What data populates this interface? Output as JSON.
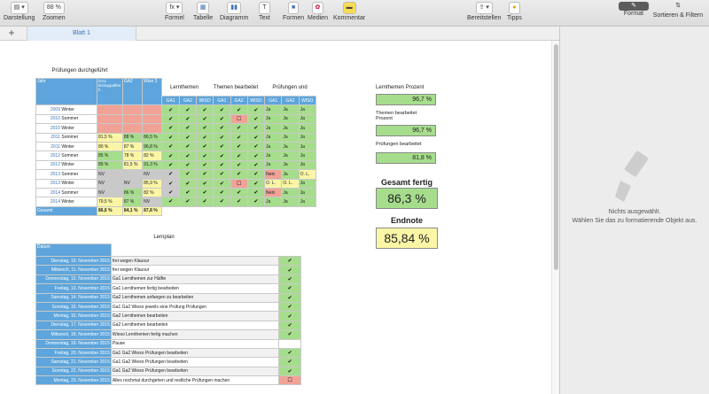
{
  "toolbar": {
    "items": [
      {
        "icon": "sidebar-icon",
        "label": "Darstellung"
      },
      {
        "icon": "zoom",
        "value": "88 %",
        "label": "Zoomen"
      },
      {
        "icon": "fx-icon",
        "label": "Formel"
      },
      {
        "icon": "table-icon",
        "label": "Tabelle"
      },
      {
        "icon": "chart-icon",
        "label": "Diagramm"
      },
      {
        "icon": "text-icon",
        "label": "Text"
      },
      {
        "icon": "shapes-icon",
        "label": "Formen"
      },
      {
        "icon": "media-icon",
        "label": "Medien"
      },
      {
        "icon": "comment-icon",
        "label": "Kommentar"
      },
      {
        "icon": "share-icon",
        "label": "Bereitstellen"
      },
      {
        "icon": "lightbulb-icon",
        "label": "Tipps"
      },
      {
        "icon": "paintbrush-icon",
        "label": "Format"
      },
      {
        "icon": "sort-icon",
        "label": "Sortieren & Filtern"
      }
    ]
  },
  "tabs": {
    "add": "+",
    "sheet1": "Blatt 1"
  },
  "headings": {
    "pruefungen": "Prüfungen durchgeführt",
    "lernthemen": "Lernthemen",
    "themen": "Themen bearbeitet",
    "pruefungen_und": "Prüfungen und",
    "lernplan": "Lernplan"
  },
  "exams_header": {
    "jahr": "Jahr",
    "ga1": "GA1 lschuppaffen h",
    "ga2": "GA2",
    "wiso": "Wiso 3",
    "sub": [
      "GA1",
      "GA2",
      "WISO",
      "GA1",
      "GA2",
      "WISO",
      "GA1",
      "GA2",
      "WISO"
    ]
  },
  "exams_rows": [
    {
      "y": "2009",
      "t": "Winter",
      "v": [
        "",
        "",
        ""
      ],
      "c": [
        "r",
        "r",
        "r"
      ],
      "k": [
        "✔",
        "✔",
        "✔",
        "✔",
        "✔",
        "✔",
        "Ja",
        "Ja",
        "Ja"
      ],
      "kc": [
        "g",
        "g",
        "g",
        "g",
        "g",
        "g",
        "g",
        "g",
        "g"
      ]
    },
    {
      "y": "2010",
      "t": "Sommer",
      "v": [
        "",
        "",
        ""
      ],
      "c": [
        "r",
        "r",
        "r"
      ],
      "k": [
        "✔",
        "✔",
        "✔",
        "✔",
        "☐",
        "✔",
        "Ja",
        "Ja",
        "Ja"
      ],
      "kc": [
        "g",
        "g",
        "g",
        "g",
        "r",
        "g",
        "g",
        "g",
        "g"
      ]
    },
    {
      "y": "2010",
      "t": "Winter",
      "v": [
        "",
        "",
        ""
      ],
      "c": [
        "r",
        "r",
        "r"
      ],
      "k": [
        "✔",
        "✔",
        "✔",
        "✔",
        "✔",
        "✔",
        "Ja",
        "Ja",
        "Ja"
      ],
      "kc": [
        "g",
        "g",
        "g",
        "g",
        "g",
        "g",
        "g",
        "g",
        "g"
      ]
    },
    {
      "y": "2011",
      "t": "Sommer",
      "v": [
        "81,5 %",
        "88 %",
        "86,5 %"
      ],
      "c": [
        "y",
        "g",
        "g"
      ],
      "k": [
        "✔",
        "✔",
        "✔",
        "✔",
        "✔",
        "✔",
        "Ja",
        "Ja",
        "Ja"
      ],
      "kc": [
        "g",
        "g",
        "g",
        "g",
        "g",
        "g",
        "g",
        "g",
        "g"
      ]
    },
    {
      "y": "2011",
      "t": "Winter",
      "v": [
        "80 %",
        "87 %",
        "96,8 %"
      ],
      "c": [
        "y",
        "y",
        "g"
      ],
      "k": [
        "✔",
        "✔",
        "✔",
        "✔",
        "✔",
        "✔",
        "Ja",
        "Ja",
        "Ja"
      ],
      "kc": [
        "g",
        "g",
        "g",
        "g",
        "g",
        "g",
        "g",
        "g",
        "g"
      ]
    },
    {
      "y": "2012",
      "t": "Sommer",
      "v": [
        "85 %",
        "78 %",
        "82 %"
      ],
      "c": [
        "g",
        "y",
        "y"
      ],
      "k": [
        "✔",
        "✔",
        "✔",
        "✔",
        "✔",
        "✔",
        "Ja",
        "Ja",
        "Ja"
      ],
      "kc": [
        "g",
        "g",
        "g",
        "g",
        "g",
        "g",
        "g",
        "g",
        "g"
      ]
    },
    {
      "y": "2012",
      "t": "Winter",
      "v": [
        "89 %",
        "81,5 %",
        "91,3 %"
      ],
      "c": [
        "g",
        "y",
        "g"
      ],
      "k": [
        "✔",
        "✔",
        "✔",
        "✔",
        "✔",
        "✔",
        "Ja",
        "Ja",
        "Ja"
      ],
      "kc": [
        "g",
        "g",
        "g",
        "g",
        "g",
        "g",
        "g",
        "g",
        "g"
      ]
    },
    {
      "y": "2013",
      "t": "Sommer",
      "v": [
        "NV",
        "",
        "NV"
      ],
      "c": [
        "gy",
        "gy",
        "gy"
      ],
      "k": [
        "✔",
        "✔",
        "✔",
        "✔",
        "✔",
        "✔",
        "Nein",
        "Ja",
        "O. L."
      ],
      "kc": [
        "gy",
        "g",
        "g",
        "g",
        "g",
        "g",
        "r",
        "g",
        "y"
      ]
    },
    {
      "y": "2013",
      "t": "Winter",
      "v": [
        "NV",
        "NV",
        "85,9 %"
      ],
      "c": [
        "gy",
        "gy",
        "y"
      ],
      "k": [
        "✔",
        "✔",
        "✔",
        "✔",
        "☐",
        "✔",
        "O. L.",
        "O. L.",
        "Ja"
      ],
      "kc": [
        "gy",
        "g",
        "g",
        "g",
        "r",
        "g",
        "y",
        "y",
        "g"
      ]
    },
    {
      "y": "2014",
      "t": "Sommer",
      "v": [
        "NV",
        "86 %",
        "82 %"
      ],
      "c": [
        "gy",
        "g",
        "y"
      ],
      "k": [
        "✔",
        "✔",
        "✔",
        "✔",
        "✔",
        "✔",
        "Nein",
        "Ja",
        "Ja"
      ],
      "kc": [
        "gy",
        "g",
        "g",
        "g",
        "g",
        "g",
        "r",
        "g",
        "g"
      ]
    },
    {
      "y": "2014",
      "t": "Winter",
      "v": [
        "79,5 %",
        "87 %",
        "NV"
      ],
      "c": [
        "y",
        "g",
        "gy"
      ],
      "k": [
        "✔",
        "✔",
        "✔",
        "✔",
        "✔",
        "✔",
        "Ja",
        "Ja",
        "Ja"
      ],
      "kc": [
        "g",
        "g",
        "g",
        "g",
        "g",
        "g",
        "g",
        "g",
        "g"
      ]
    }
  ],
  "exams_total": {
    "label": "Gesamt",
    "v": [
      "86,6 %",
      "84,1 %",
      "87,8 %"
    ]
  },
  "summary": {
    "lernthemen_label": "Lernthemen Prozent",
    "lernthemen": "96,7 %",
    "themen_label": "Themen bearbeitet Prozent",
    "themen": "96,7 %",
    "pruef_label": "Prüfungen bearbeitet",
    "pruef": "81,8 %",
    "gesamt_label": "Gesamt fertig",
    "gesamt": "86,3 %",
    "note_label": "Endnote",
    "note": "85,84 %"
  },
  "plan": {
    "header": "Datum",
    "rows": [
      {
        "d": "Dienstag, 10. November 2015",
        "t": "frei wegen Klausur",
        "k": "✔",
        "c": "g"
      },
      {
        "d": "Mittwoch, 11. November 2015",
        "t": "frei wegen Klausur",
        "k": "✔",
        "c": "g"
      },
      {
        "d": "Donnerstag, 12. November 2015",
        "t": "Ga1 Lernthemen zur Hälfte",
        "k": "✔",
        "c": "g"
      },
      {
        "d": "Freitag, 13. November 2015",
        "t": "Ga1 Lernthemen fertig bearbeiten",
        "k": "✔",
        "c": "g"
      },
      {
        "d": "Samstag, 14. November 2015",
        "t": "Ga2 Lernthemen anfangen zu bearbeiten",
        "k": "✔",
        "c": "g"
      },
      {
        "d": "Sonntag, 15. November 2015",
        "t": "Ga1 Ga2 Wieso jeweils eine Prüfung Prüfungen",
        "k": "✔",
        "c": "g"
      },
      {
        "d": "Montag, 16. November 2015",
        "t": "Ga2 Lernthemen bearbeiten",
        "k": "✔",
        "c": "g"
      },
      {
        "d": "Dienstag, 17. November 2015",
        "t": "Ga2 Lernthemen bearbeiten",
        "k": "✔",
        "c": "g"
      },
      {
        "d": "Mittwoch, 18. November 2015",
        "t": "Wieso Lernthemen fertig machen",
        "k": "✔",
        "c": "g"
      },
      {
        "d": "Donnerstag, 19. November 2015",
        "t": "Pause",
        "k": "",
        "c": ""
      },
      {
        "d": "Freitag, 20. November 2015",
        "t": "Ga1 Ga2 Wieso Prüfungen bearbeiten",
        "k": "✔",
        "c": "g"
      },
      {
        "d": "Samstag, 21. November 2015",
        "t": "Ga1 Ga2 Wieso Prüfungen bearbeiten",
        "k": "✔",
        "c": "g"
      },
      {
        "d": "Sonntag, 22. November 2015",
        "t": "Ga1 Ga2 Wieso Prüfungen bearbeiten",
        "k": "✔",
        "c": "g"
      },
      {
        "d": "Montag, 23. November 2015",
        "t": "Alles nochmal durchgehen und restliche Prüfungen machen",
        "k": "☐",
        "c": "r"
      }
    ]
  },
  "panel": {
    "none": "Nichts ausgewählt.",
    "hint": "Wählen Sie das zu formatierende Objekt aus."
  }
}
